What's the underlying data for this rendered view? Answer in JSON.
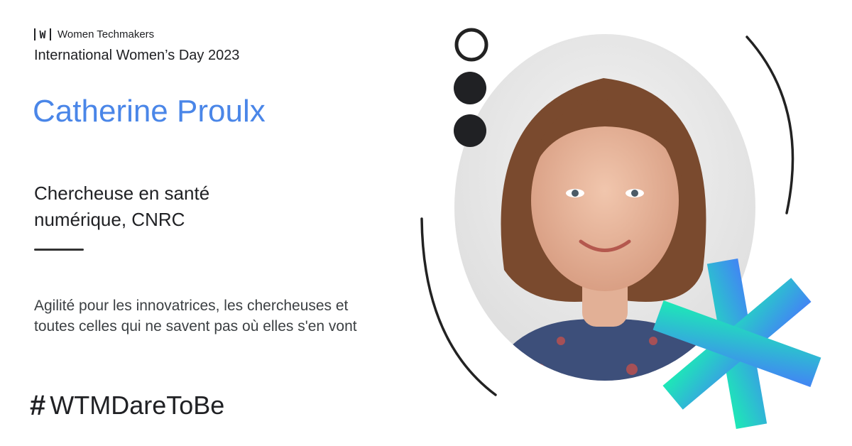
{
  "brand": {
    "logo_letter": "W",
    "name": "Women Techmakers",
    "event": "International Women’s Day 2023"
  },
  "speaker": {
    "name": "Catherine Proulx",
    "role": "Chercheuse en santé numérique, CNRC"
  },
  "talk": {
    "title": "Agilité pour les innovatrices, les chercheuses et toutes celles qui ne savent pas où elles s'en vont"
  },
  "campaign": {
    "hashtag_symbol": "#",
    "hashtag": "WTMDareToBe"
  },
  "colors": {
    "name_blue": "#4a86e8",
    "text_dark": "#202124",
    "accent_gradient_start": "#1de9b6",
    "accent_gradient_end": "#4285f4"
  },
  "icons": {
    "logo": "w-bracket-logo",
    "hashtag": "hash-icon",
    "decor": [
      "outline-circle",
      "filled-circle",
      "filled-circle",
      "asterisk-star",
      "arc-lines"
    ]
  }
}
